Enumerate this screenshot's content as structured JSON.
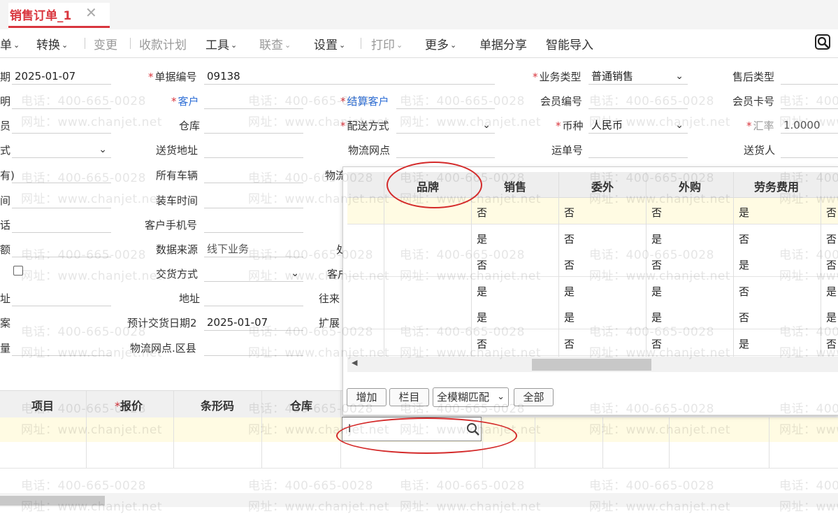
{
  "tab": {
    "title": "销售订单_1",
    "close": "✕"
  },
  "toolbar": {
    "items": [
      {
        "label": "单",
        "caret": "⌄"
      },
      {
        "label": "转换",
        "caret": "⌄"
      },
      {
        "label": "变更"
      },
      {
        "label": "收款计划"
      },
      {
        "label": "工具",
        "caret": "⌄"
      },
      {
        "label": "联查",
        "caret": "⌄"
      },
      {
        "label": "设置",
        "caret": "⌄"
      },
      {
        "label": "打印",
        "caret": "⌄"
      },
      {
        "label": "更多",
        "caret": "⌄"
      },
      {
        "label": "单据分享"
      },
      {
        "label": "智能导入"
      }
    ]
  },
  "form": {
    "left_labels": [
      "期",
      "明",
      "员",
      "式",
      "有)",
      "间",
      "话",
      "额",
      "",
      "址",
      "案",
      "量"
    ],
    "date_value": "2025-01-07",
    "dropdown_glyph": "⌄",
    "col2": {
      "labels": [
        "单据编号",
        "客户",
        "仓库",
        "送货地址",
        "所有车辆",
        "装车时间",
        "客户手机号",
        "数据来源",
        "交货方式",
        "地址",
        "预计交货日期2",
        "物流网点.区县"
      ],
      "doc_no": "09138",
      "data_source": "线下业务",
      "expected_date": "2025-01-07"
    },
    "col3": {
      "labels": [
        "结算客户",
        "配送方式",
        "物流网点"
      ],
      "partial_labels": [
        "物流",
        "处",
        "客户",
        "往来",
        "扩展"
      ]
    },
    "col4": {
      "labels": [
        "业务类型",
        "会员编号",
        "币种",
        "运单号"
      ],
      "business_type": "普通销售",
      "currency": "人民币"
    },
    "col5": {
      "labels": [
        "售后类型",
        "会员卡号",
        "汇率",
        "送货人"
      ],
      "rate": "1.0000"
    }
  },
  "grid": {
    "headers": [
      "项目",
      "报价",
      "条形码",
      "仓库"
    ],
    "input_value": "l"
  },
  "popup": {
    "headers": [
      "品牌",
      "销售",
      "委外",
      "外购",
      "劳务费用"
    ],
    "rows": [
      [
        "否",
        "否",
        "否",
        "是",
        "否"
      ],
      [
        "是",
        "否",
        "是",
        "否",
        "否"
      ],
      [
        "否",
        "否",
        "否",
        "是",
        "否"
      ],
      [
        "是",
        "是",
        "是",
        "否",
        "是"
      ],
      [
        "是",
        "是",
        "是",
        "否",
        "是"
      ],
      [
        "否",
        "否",
        "否",
        "是",
        "否"
      ]
    ],
    "buttons": {
      "add": "增加",
      "columns": "栏目",
      "match": "全模糊匹配",
      "all": "全部"
    },
    "scroll_left": "◀"
  },
  "watermark": {
    "phone": "电话：400-665-0028",
    "url": "网址：www.chanjet.net"
  },
  "colors": {
    "accent": "#d9363e",
    "link": "#2f6fd6",
    "selected_row": "#fffbe3",
    "annotation": "#d42a2a"
  }
}
